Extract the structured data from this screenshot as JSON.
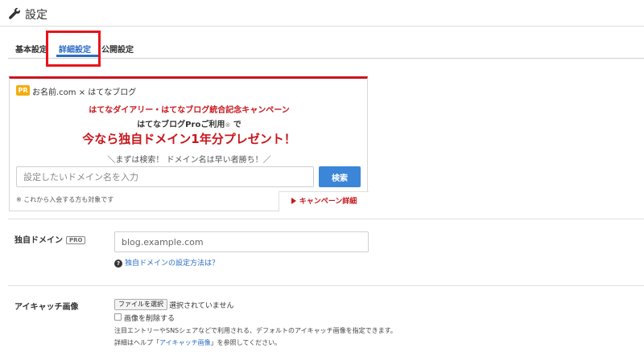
{
  "header": {
    "icon": "wrench-icon",
    "title": "設定"
  },
  "tabs": [
    {
      "label": "基本設定"
    },
    {
      "label": "詳細設定",
      "active": true
    },
    {
      "label": "公開設定"
    }
  ],
  "banner": {
    "badge": "PR",
    "partner": "お名前.com × はてなブログ",
    "campaign": "はてなダイアリー・はてなブログ統合記念キャンペーン",
    "subline": "はてなブログProご利用",
    "subline_reg": "®",
    "subline_tail": " で",
    "headline": "今なら独自ドメイン1年分プレゼント！",
    "note": "＼まずは検索！ ドメイン名は早い者勝ち！／",
    "input_placeholder": "設定したいドメイン名を入力",
    "search_label": "検索",
    "fine_print": "※ これから入会する方も対象です",
    "detail_label": "キャンペーン詳細"
  },
  "domain": {
    "label": "独自ドメイン",
    "badge": "PRO",
    "placeholder": "blog.example.com",
    "help_link": "独自ドメインの設定方法は？"
  },
  "eyecatch": {
    "label": "アイキャッチ画像",
    "file_button": "ファイルを選択",
    "file_status": "選択されていません",
    "delete_label": "画像を削除する",
    "desc1": "注目エントリーやSNSシェアなどで利用される、デフォルトのアイキャッチ画像を指定できます。",
    "desc2_pre": "詳細はヘルプ「",
    "desc2_link": "アイキャッチ画像",
    "desc2_post": "」を参照してください。"
  },
  "colors": {
    "accent_blue": "#2a6cc5",
    "campaign_red": "#c8161d",
    "highlight_red": "#e8141a",
    "pr_yellow": "#f4ad0e"
  }
}
